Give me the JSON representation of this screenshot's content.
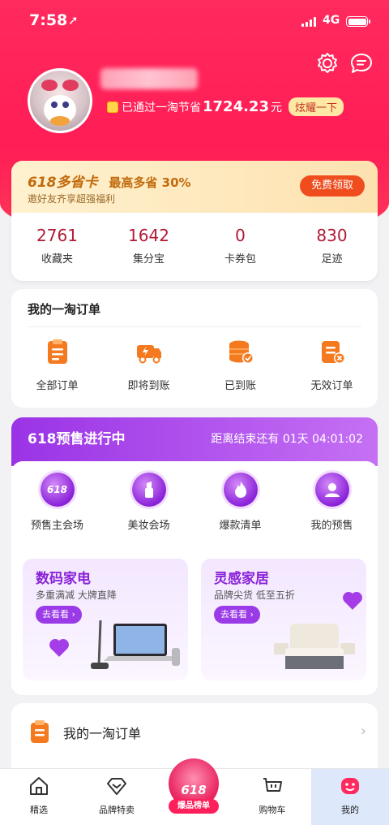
{
  "status_bar": {
    "time": "7:58",
    "network": "4G"
  },
  "profile": {
    "savings_prefix": "已通过一淘节省",
    "savings_amount": "1724.23",
    "savings_unit": "元",
    "show_off_label": "炫耀一下"
  },
  "vip_card": {
    "title": "618多省卡",
    "highlight": "最高多省 30%",
    "subtitle": "邀好友齐享超强福利",
    "claim_button": "免费领取"
  },
  "stats": [
    {
      "value": "2761",
      "label": "收藏夹"
    },
    {
      "value": "1642",
      "label": "集分宝"
    },
    {
      "value": "0",
      "label": "卡券包"
    },
    {
      "value": "830",
      "label": "足迹"
    }
  ],
  "orders": {
    "title": "我的一淘订单",
    "items": [
      {
        "label": "全部订单",
        "icon": "clipboard-icon"
      },
      {
        "label": "即将到账",
        "icon": "truck-icon"
      },
      {
        "label": "已到账",
        "icon": "coins-check-icon"
      },
      {
        "label": "无效订单",
        "icon": "invalid-order-icon"
      }
    ]
  },
  "presale": {
    "title": "618预售进行中",
    "countdown": "距离结束还有 01天 04:01:02",
    "venues": [
      {
        "label": "预售主会场",
        "badge": "618"
      },
      {
        "label": "美妆会场",
        "badge": ""
      },
      {
        "label": "爆款清单",
        "badge": ""
      },
      {
        "label": "我的预售",
        "badge": ""
      }
    ],
    "promos": [
      {
        "title": "数码家电",
        "subtitle": "多重满减 大牌直降",
        "button": "去看看"
      },
      {
        "title": "灵感家居",
        "subtitle": "品牌尖货 低至五折",
        "button": "去看看"
      }
    ]
  },
  "orders_entry": {
    "label": "我的一淘订单"
  },
  "tabbar": {
    "tabs": [
      {
        "label": "精选"
      },
      {
        "label": "品牌特卖"
      },
      {
        "label": "爆品榜单",
        "badge": "618"
      },
      {
        "label": "购物车"
      },
      {
        "label": "我的"
      }
    ]
  },
  "colors": {
    "brand_red": "#ff2a5e",
    "presale_purple": "#9a33e6",
    "vip_orange": "#f04d1f"
  }
}
